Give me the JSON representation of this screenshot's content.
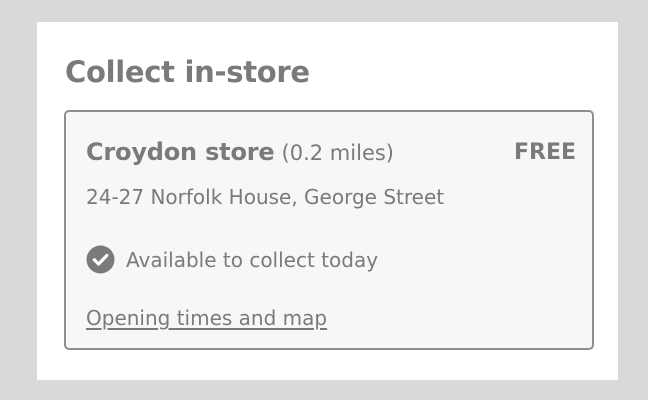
{
  "section": {
    "title": "Collect in-store"
  },
  "store": {
    "name": "Croydon store",
    "distance": "(0.2 miles)",
    "price": "FREE",
    "address": "24-27 Norfolk House, George Street",
    "availability_icon": "check-circle-icon",
    "availability": "Available to collect today",
    "opening_link": "Opening times and map"
  },
  "colors": {
    "background": "#d9d9d9",
    "panel": "#ffffff",
    "card_background": "#f7f7f7",
    "card_border": "#8e8e8e",
    "text": "#7a7a7a"
  }
}
